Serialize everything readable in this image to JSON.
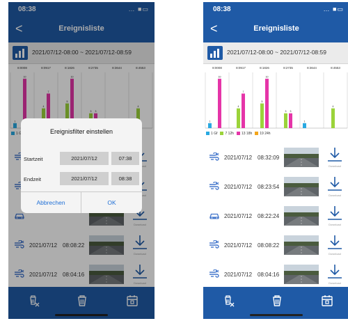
{
  "status_time": "08:38",
  "nav_title": "Ereignisliste",
  "back_glyph": "<",
  "date_range": "2021/07/12-08:00 ~ 2021/07/12-08:59",
  "chart_data": {
    "type": "bar",
    "categories": [
      "8:00-08",
      "8:09-17",
      "8:18-26",
      "8:27-35",
      "8:36-44",
      "8:45-53"
    ],
    "left_tick_labels": [
      "8:0008",
      "8:0917",
      "8:1826",
      "8:2735",
      "8:3644",
      "8:4553"
    ],
    "right_tick_labels": [
      "8:0008",
      "8:0917",
      "8:1826",
      "8:2735",
      "8:3644",
      "8:4553"
    ],
    "series": [
      {
        "name": "1 Gf",
        "color": "#29a9e1",
        "values": [
          1,
          0,
          0,
          0,
          1,
          0
        ]
      },
      {
        "name": "7 12h",
        "color": "#9bd33a",
        "values": [
          0,
          4,
          5,
          3,
          0,
          4
        ]
      },
      {
        "name": "13 18h",
        "color": "#e535a8",
        "values": [
          10,
          7,
          10,
          3,
          0,
          0
        ]
      },
      {
        "name": "19 24h",
        "color": "#f3a51a",
        "values": [
          0,
          0,
          0,
          0,
          0,
          0
        ]
      }
    ],
    "ylim": [
      0,
      11
    ]
  },
  "legend": [
    "1 Gf",
    "7 12h",
    "13 18h",
    "19 24h"
  ],
  "colors": {
    "primary": "#1f5aa6",
    "accent": "#1f6fd6",
    "icon": "#4477cc"
  },
  "left_rows": [
    {
      "icon": "wind-icon",
      "date": "",
      "time": ""
    },
    {
      "icon": "wind-icon",
      "date": "",
      "time": ""
    },
    {
      "icon": "car-icon",
      "date": "",
      "time": ""
    },
    {
      "icon": "wind-icon",
      "date": "2021/07/12",
      "time": "08:08:22"
    },
    {
      "icon": "wind-icon",
      "date": "2021/07/12",
      "time": "08:04:16"
    }
  ],
  "right_rows": [
    {
      "icon": "wind-icon",
      "date": "2021/07/12",
      "time": "08:32:09"
    },
    {
      "icon": "wind-icon",
      "date": "2021/07/12",
      "time": "08:23:54"
    },
    {
      "icon": "car-icon",
      "date": "2021/07/12",
      "time": "08:22:24"
    },
    {
      "icon": "wind-icon",
      "date": "2021/07/12",
      "time": "08:08:22"
    },
    {
      "icon": "wind-icon",
      "date": "2021/07/12",
      "time": "08:04:16"
    }
  ],
  "download_caption": "Download",
  "dialog": {
    "title": "Ereignisfilter einstellen",
    "start_label": "Startzeit",
    "start_date": "2021/07/12",
    "start_time": "07:38",
    "end_label": "Endzeit",
    "end_date": "2021/07/12",
    "end_time": "08:38",
    "cancel": "Abbrechen",
    "ok": "OK"
  },
  "tabbar_icons": [
    "delete-selected-icon",
    "trash-icon",
    "calendar-icon"
  ]
}
